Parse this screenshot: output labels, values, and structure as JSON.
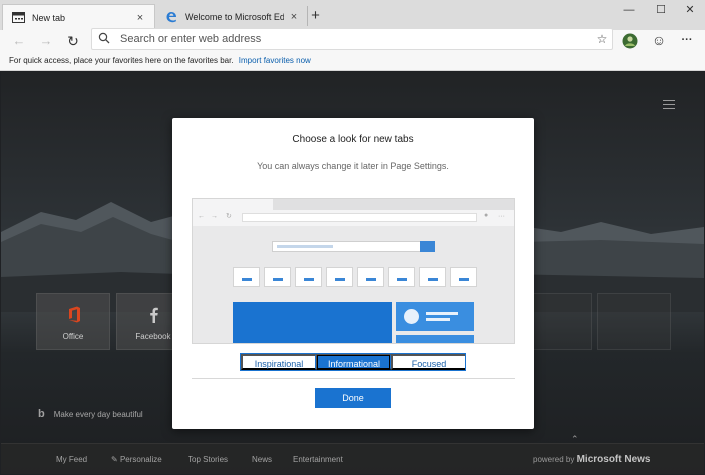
{
  "colors": {
    "accent": "#1a73d0",
    "link": "#0b5fad",
    "tab_bg": "#f7f7f7",
    "frame": "#dcdcdc"
  },
  "tabs": [
    {
      "label": "New tab",
      "icon": "newtab-page-icon",
      "active": true,
      "close": "×"
    },
    {
      "label": "Welcome to Microsoft Edge Dev",
      "icon": "edge-logo-icon",
      "active": false,
      "close": "×"
    }
  ],
  "new_tab_button": "+",
  "window_controls": {
    "minimize": "—",
    "maximize": "☐",
    "close": "✕"
  },
  "toolbar": {
    "back": "←",
    "forward": "→",
    "refresh": "↻",
    "address_placeholder": "Search or enter web address",
    "favorite_star": "☆",
    "emoji": "☺",
    "more": "···"
  },
  "favorites_bar": {
    "text": "For quick access, place your favorites here on the favorites bar.",
    "link": "Import favorites now"
  },
  "new_tab_page": {
    "tiles": [
      {
        "label": "Office",
        "icon": "office-icon"
      },
      {
        "label": "Facebook",
        "icon": "facebook-icon"
      }
    ],
    "tagline": "Make every day beautiful",
    "bing_mark": "b",
    "news": [
      "My Feed",
      "Personalize",
      "Top Stories",
      "News",
      "Entertainment"
    ],
    "powered_prefix": "powered by",
    "powered_brand": "Microsoft News"
  },
  "modal": {
    "title": "Choose a look for new tabs",
    "subtitle": "You can always change it later in Page Settings.",
    "options": [
      "Inspirational",
      "Informational",
      "Focused"
    ],
    "selected_option": "Informational",
    "done": "Done"
  }
}
